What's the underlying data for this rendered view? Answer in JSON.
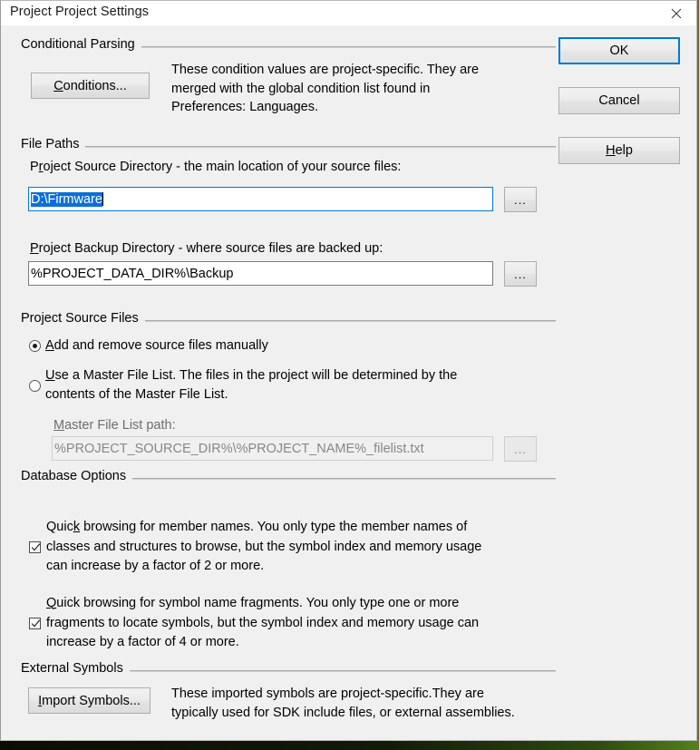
{
  "window": {
    "title": "Project Project Settings",
    "close_icon": "close-icon"
  },
  "action_buttons": {
    "ok": "OK",
    "cancel": "Cancel",
    "help_pre": "H",
    "help_post": "elp"
  },
  "conditional_parsing": {
    "group_label": "Conditional Parsing",
    "button_pre": "C",
    "button_post": "onditions...",
    "description": "These condition values are project-specific.  They are\nmerged with the global condition list found in\nPreferences: Languages."
  },
  "file_paths": {
    "group_label": "File Paths",
    "source_label_a": "P",
    "source_label_b": "r",
    "source_label_c": "oject Source Directory - the main location of your source files:",
    "source_value": "D:\\Firmware",
    "source_browse": "...",
    "backup_label_a": "P",
    "backup_label_b": "roject Backup Directory - where source files are backed up:",
    "backup_value": "%PROJECT_DATA_DIR%\\Backup",
    "backup_browse": "..."
  },
  "project_source_files": {
    "group_label": "Project Source Files",
    "option_manual_pre": "A",
    "option_manual_post": "dd and remove source files manually",
    "option_manual_selected": true,
    "option_master_pre": "U",
    "option_master_post": "se a Master File List. The files in the project will be determined by the\ncontents of the Master File List.",
    "option_master_selected": false,
    "master_path_label_pre": "M",
    "master_path_label_post": "aster File List path:",
    "master_path_value": "%PROJECT_SOURCE_DIR%\\%PROJECT_NAME%_filelist.txt",
    "master_path_browse": "...",
    "master_path_disabled": true
  },
  "database_options": {
    "group_label": "Database Options",
    "items": [
      {
        "checked": true,
        "text_a": "Quic",
        "text_b": "k",
        "text_c": " browsing for member names.  You only type the member names of\nclasses and structures to browse, but the symbol index and memory usage\ncan increase by a factor of 2 or more."
      },
      {
        "checked": true,
        "text_a": "",
        "text_b": "Q",
        "text_c": "uick browsing for symbol name fragments.  You only type one or more\nfragments to locate symbols, but the symbol index and memory usage can\nincrease by a factor of 4 or more."
      }
    ]
  },
  "external_symbols": {
    "group_label": "External Symbols",
    "button_pre": "I",
    "button_post": "mport Symbols...",
    "description": "These imported symbols are project-specific.They are\ntypically used for SDK include files, or external assemblies."
  },
  "colors": {
    "dialog_bg": "#f0f0f0",
    "accent_focus": "#0078d7",
    "selection": "#0b6fd8",
    "group_line": "#a9a9a9"
  }
}
